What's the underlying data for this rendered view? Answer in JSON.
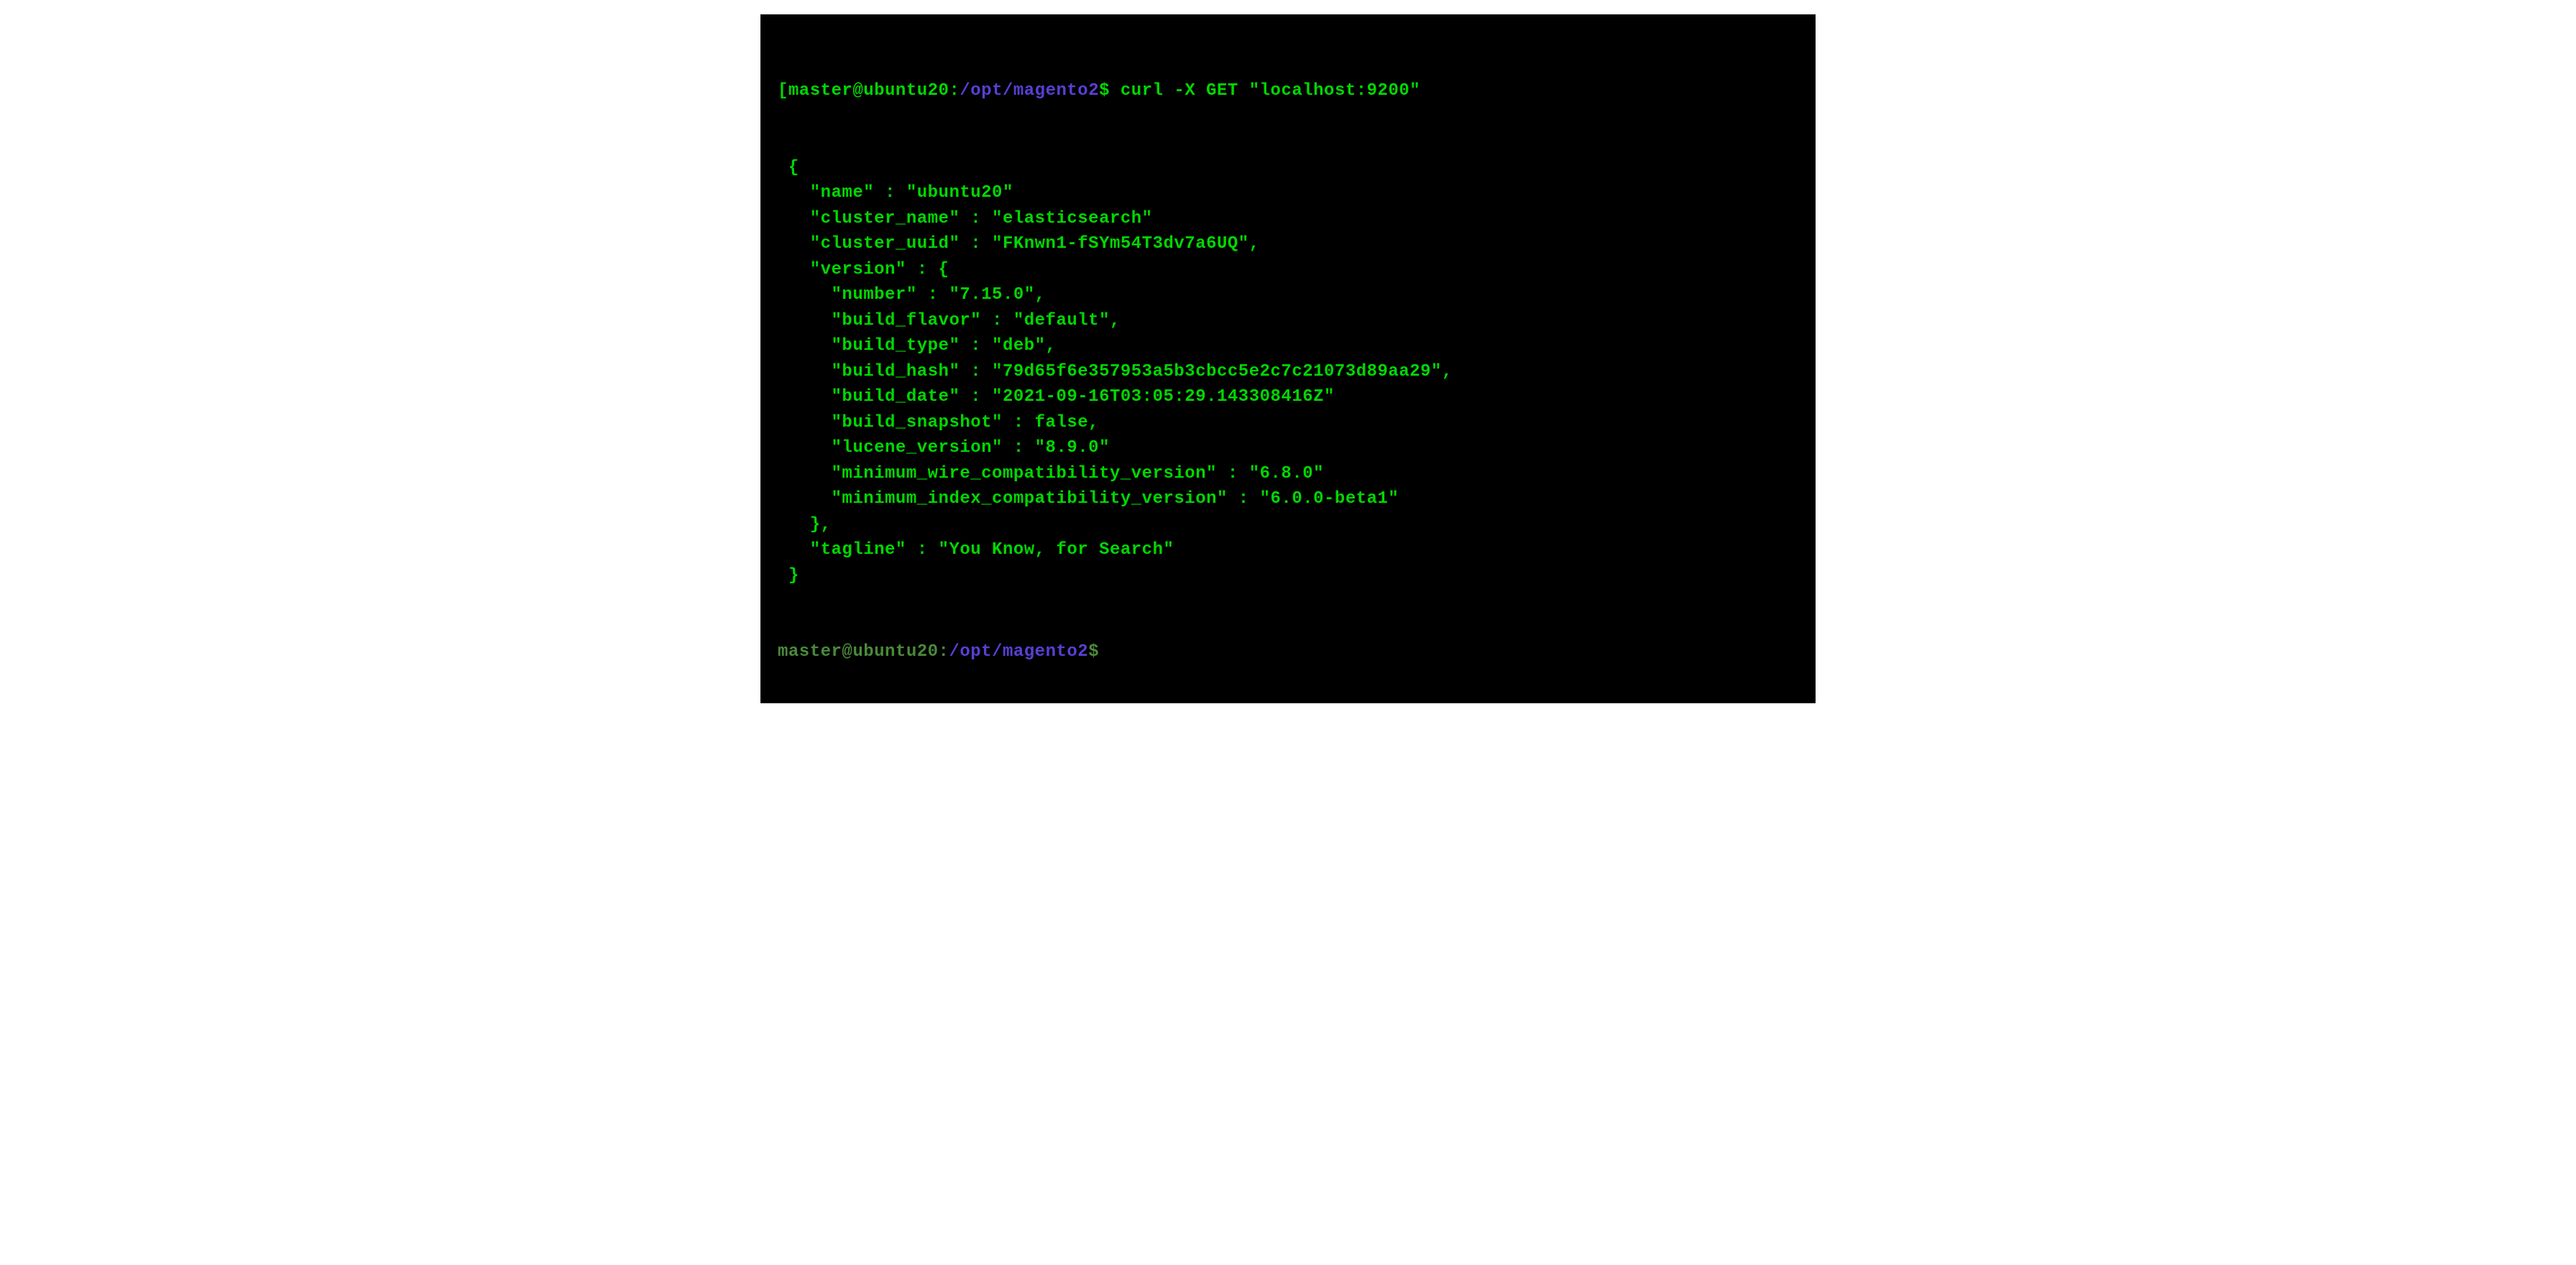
{
  "prompt1": {
    "bracket": "[",
    "user_host": "master@ubuntu20",
    "colon": ":",
    "path": "/opt/magento2",
    "dollar": "$",
    "command": " curl -X GET \"localhost:9200\""
  },
  "output_lines": [
    " {",
    "   \"name\" : \"ubuntu20\"",
    "   \"cluster_name\" : \"elasticsearch\"",
    "   \"cluster_uuid\" : \"FKnwn1-fSYm54T3dv7a6UQ\",",
    "   \"version\" : {",
    "     \"number\" : \"7.15.0\",",
    "     \"build_flavor\" : \"default\",",
    "     \"build_type\" : \"deb\",",
    "     \"build_hash\" : \"79d65f6e357953a5b3cbcc5e2c7c21073d89aa29\",",
    "     \"build_date\" : \"2021-09-16T03:05:29.143308416Z\"",
    "     \"build_snapshot\" : false,",
    "     \"lucene_version\" : \"8.9.0\"",
    "     \"minimum_wire_compatibility_version\" : \"6.8.0\"",
    "     \"minimum_index_compatibility_version\" : \"6.0.0-beta1\"",
    "   },",
    "   \"tagline\" : \"You Know, for Search\"",
    " }"
  ],
  "prompt2": {
    "user_host": "master@ubuntu20",
    "colon": ":",
    "path": "/opt/magento2",
    "dollar": "$"
  }
}
